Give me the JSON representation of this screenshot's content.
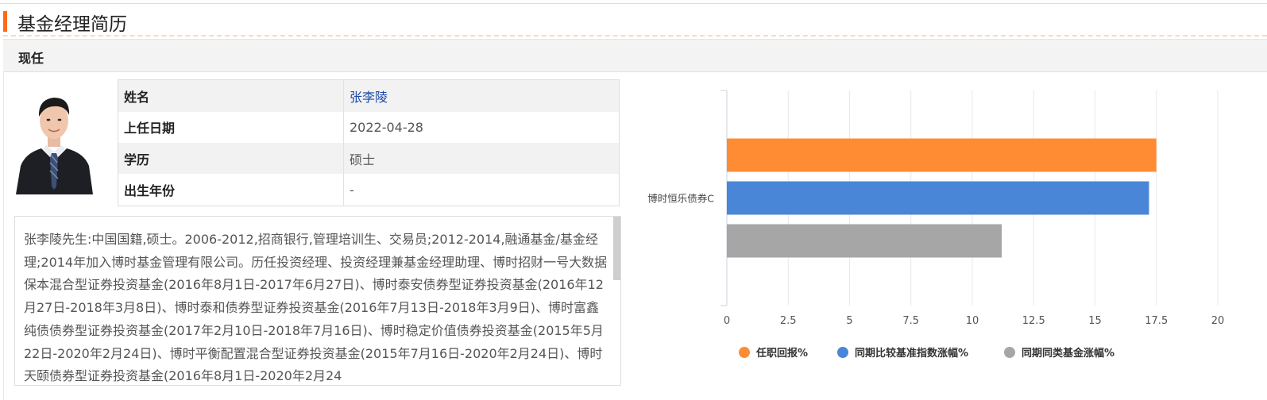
{
  "section_title": "基金经理简历",
  "subheader": "现任",
  "manager": {
    "rows": [
      {
        "key": "姓名",
        "value": "张李陵"
      },
      {
        "key": "上任日期",
        "value": "2022-04-28"
      },
      {
        "key": "学历",
        "value": "硕士"
      },
      {
        "key": "出生年份",
        "value": "-"
      }
    ],
    "bio": "张李陵先生:中国国籍,硕士。2006-2012,招商银行,管理培训生、交易员;2012-2014,融通基金/基金经理;2014年加入博时基金管理有限公司。历任投资经理、投资经理兼基金经理助理、博时招财一号大数据保本混合型证券投资基金(2016年8月1日-2017年6月27日)、博时泰安债券型证券投资基金(2016年12月27日-2018年3月8日)、博时泰和债券型证券投资基金(2016年7月13日-2018年3月9日)、博时富鑫纯债债券型证券投资基金(2017年2月10日-2018年7月16日)、博时稳定价值债券投资基金(2015年5月22日-2020年2月24日)、博时平衡配置混合型证券投资基金(2015年7月16日-2020年2月24日)、博时天颐债券型证券投资基金(2016年8月1日-2020年2月24"
  },
  "chart_data": {
    "type": "bar",
    "orientation": "horizontal",
    "categories": [
      "博时恒乐债券C"
    ],
    "series": [
      {
        "name": "任职回报%",
        "values": [
          17.5
        ],
        "color": "#ff8c33"
      },
      {
        "name": "同期比较基准指数涨幅%",
        "values": [
          17.2
        ],
        "color": "#4a86d8"
      },
      {
        "name": "同期同类基金涨幅%",
        "values": [
          11.2
        ],
        "color": "#a6a6a6"
      }
    ],
    "xlim": [
      0,
      20
    ],
    "xticks": [
      "0",
      "2.5",
      "5",
      "7.5",
      "10",
      "12.5",
      "15",
      "17.5",
      "20"
    ],
    "grid": true,
    "legend_position": "bottom"
  }
}
